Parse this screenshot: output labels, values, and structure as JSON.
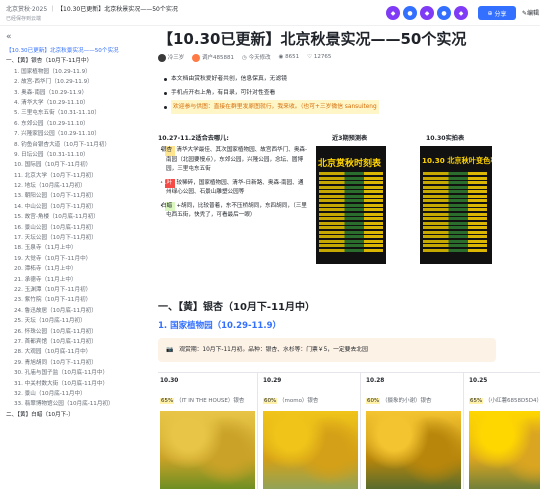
{
  "topbar": {
    "crumbs": [
      "北京赏秋·2025",
      "【10.30已更新】北京秋景实况——50个实况"
    ],
    "saved": "已经保存到云端",
    "share_label": "分享",
    "edit_label": "编辑"
  },
  "toc": {
    "active": "【10.30已更新】北京秋景实况——50个实况",
    "items": [
      {
        "t": "一、【黄】银杏（10月下-11月中）",
        "lvl": 1
      },
      {
        "t": "1. 国家植物园（10.29-11.9）",
        "lvl": 2
      },
      {
        "t": "2. 故宫-西华门（10.29-11.9）",
        "lvl": 2
      },
      {
        "t": "3. 奥森-南园（10.29-11.9）",
        "lvl": 2
      },
      {
        "t": "4. 清华大学（10.29-11.10）",
        "lvl": 2
      },
      {
        "t": "5. 三里屯东五街（10.31-11.10）",
        "lvl": 2
      },
      {
        "t": "6. 东郊公园（10.29-11.10）",
        "lvl": 2
      },
      {
        "t": "7. 兴隆家园公园（10.29-11.10）",
        "lvl": 2
      },
      {
        "t": "8. 钓鱼台银杏大道（10月下-11月初）",
        "lvl": 2
      },
      {
        "t": "9. 日坛公园（10.31-11.10）",
        "lvl": 2
      },
      {
        "t": "10. 国际园（10月下-11月初）",
        "lvl": 2
      },
      {
        "t": "11. 北京大学（10月下-11月初）",
        "lvl": 2
      },
      {
        "t": "12. 地坛（10月底-11月初）",
        "lvl": 2
      },
      {
        "t": "13. 朝阳公园（10月下-11月初）",
        "lvl": 2
      },
      {
        "t": "14. 中山公园（10月下-11月初）",
        "lvl": 2
      },
      {
        "t": "15. 故宫-角楼（10月底-11月初）",
        "lvl": 2
      },
      {
        "t": "16. 景山公园（10月底-11月初）",
        "lvl": 2
      },
      {
        "t": "17. 天坛公园（10月下-11月初）",
        "lvl": 2
      },
      {
        "t": "18. 玉泉寺（11月上中）",
        "lvl": 2
      },
      {
        "t": "19. 大觉寺（10月下-11月中）",
        "lvl": 2
      },
      {
        "t": "20. 潭柘寺（11月上中）",
        "lvl": 2
      },
      {
        "t": "21. 承德寺（11月上中）",
        "lvl": 2
      },
      {
        "t": "22. 玉渊潭（10月下-11月初）",
        "lvl": 2
      },
      {
        "t": "23. 紫竹院（10月下-11月初）",
        "lvl": 2
      },
      {
        "t": "24. 鲁迅故居（10月底-11月初）",
        "lvl": 2
      },
      {
        "t": "25. 天坛（10月底-11月初）",
        "lvl": 2
      },
      {
        "t": "26. 怀珠公园（10月底-11月初）",
        "lvl": 2
      },
      {
        "t": "27. 首都宾馆（10月底-11月初）",
        "lvl": 2
      },
      {
        "t": "28. 大观园（10月底-11月中）",
        "lvl": 2
      },
      {
        "t": "29. 青旭胡同（10月下-11月初）",
        "lvl": 2
      },
      {
        "t": "30. 孔庙与国子监（10月底-11月中）",
        "lvl": 2
      },
      {
        "t": "31. 中关村数大街（10月底-11月中）",
        "lvl": 2
      },
      {
        "t": "32. 景山（10月底-11月中）",
        "lvl": 2
      },
      {
        "t": "33. 翡翠博物馆公园（10月底-11月初）",
        "lvl": 2
      },
      {
        "t": "二、【黄】白蜡（10月下-）",
        "lvl": 1
      }
    ]
  },
  "doc": {
    "title": "【10.30已更新】北京秋景实况——50个实况",
    "author": "冷三岁",
    "org": "调户485881",
    "modified": "今天修改",
    "views": "8651",
    "likes": "12765",
    "bullets": [
      "本文档由赏秋爱好者共创，信息保真，无滤镜",
      "手机点开右上角，有目录，可针对性查看"
    ],
    "highlight": "欢迎参与供图：直接在群里发原图就行，我来收。（也可+三岁微信 sansuiteng"
  },
  "table": {
    "col1_header": "10.27-11.2适合去哪儿:",
    "col2_header": "近3期预测表",
    "col3_header": "10.30实拍表",
    "rows": [
      {
        "tag": "银杏",
        "tagColor": "yellow",
        "text": "清华大学最佳、其次国家植物园、故宫西华门、奥森-南园（北园要慢点），东郊公园，兴隆公园，念坛、圆博园，三里屯东五街"
      },
      {
        "tag": "红叶",
        "tagColor": "red",
        "text": "较稀碎，国家植物园、清华-日新路、奥森-南园、通州绿心公园、石景山雕塑公园等"
      },
      {
        "tag": "白蜡",
        "tagColor": "green",
        "text": "+胡同，比较普着，东不压桥胡同，东四胡同，（三里屯西五街，快秃了，可看最后一眼）"
      }
    ],
    "poster1": "北京赏秋时刻表",
    "poster2": "10.30 北京秋叶变色率"
  },
  "sections": {
    "h1": "一、【黄】银杏（10月下-11月中）",
    "h2": "1. 国家植物园（10.29-11.9）",
    "callout": "观赏期：10月下-11月初。品种：银杏、水杉等：门票￥5，一定要去北园"
  },
  "gallery": [
    {
      "date": "10.30",
      "pct": "65%",
      "cap": "（IT IN THE HOUSE）银杏"
    },
    {
      "date": "10.29",
      "pct": "60%",
      "cap": "（momo）银杏"
    },
    {
      "date": "10.28",
      "pct": "60%",
      "cap": "（摄象的小谢）银杏"
    },
    {
      "date": "10.25",
      "pct": "65%",
      "cap": "（小红薯6858D5D4）银杏"
    }
  ],
  "colors": {
    "accent": "#3370ff",
    "highlight": "#fff6c7"
  }
}
